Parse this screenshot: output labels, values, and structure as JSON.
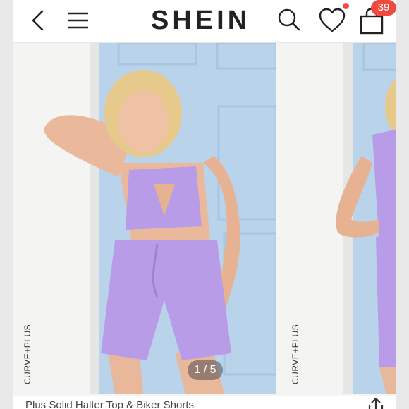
{
  "header": {
    "logo": "SHEIN",
    "cart_count": "39",
    "icons": [
      "chevron-left-icon",
      "hamburger-menu-icon",
      "search-icon",
      "heart-icon",
      "shopping-bag-icon"
    ]
  },
  "gallery": {
    "counter": "1 / 5",
    "watermark": "CURVE+PLUS",
    "outfit_color": "#b89ce8"
  },
  "product": {
    "title": "Plus Solid Halter Top & Biker Shorts"
  },
  "colors": {
    "badge": "#f04a3e",
    "text": "#222222"
  }
}
